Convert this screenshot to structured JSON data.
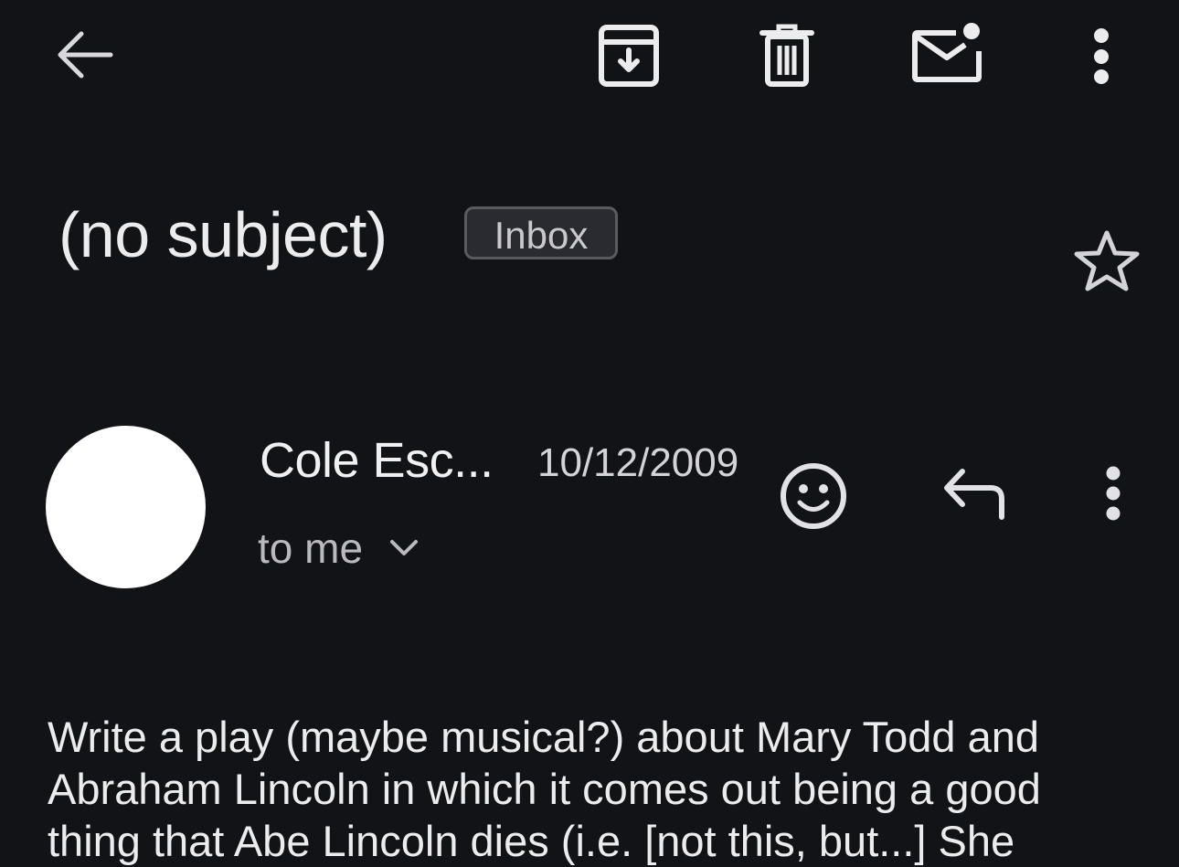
{
  "toolbar": {
    "back_icon": "arrow-back-icon",
    "archive_icon": "archive-icon",
    "delete_icon": "trash-icon",
    "mark_unread_icon": "mark-unread-icon",
    "more_icon": "more-vert-icon"
  },
  "email": {
    "subject": "(no subject)",
    "label": "Inbox",
    "starred": false,
    "sender": {
      "name": "Cole Esc...",
      "date": "10/12/2009",
      "recipient": "to me"
    },
    "body": "Write a play (maybe musical?) about Mary Todd and Abraham Lincoln in which it comes out being a good thing that Abe Lincoln dies (i.e. [not this, but...] She"
  },
  "actions": {
    "react_icon": "emoji-icon",
    "reply_icon": "reply-icon",
    "more_icon": "more-vert-icon",
    "star_icon": "star-outline-icon",
    "expand_icon": "chevron-down-icon"
  },
  "colors": {
    "background": "#121316",
    "text": "#ececee",
    "muted": "#b9b9be",
    "badge_bg": "#2a2b30",
    "badge_border": "#5a5b60",
    "avatar": "#ffffff"
  }
}
